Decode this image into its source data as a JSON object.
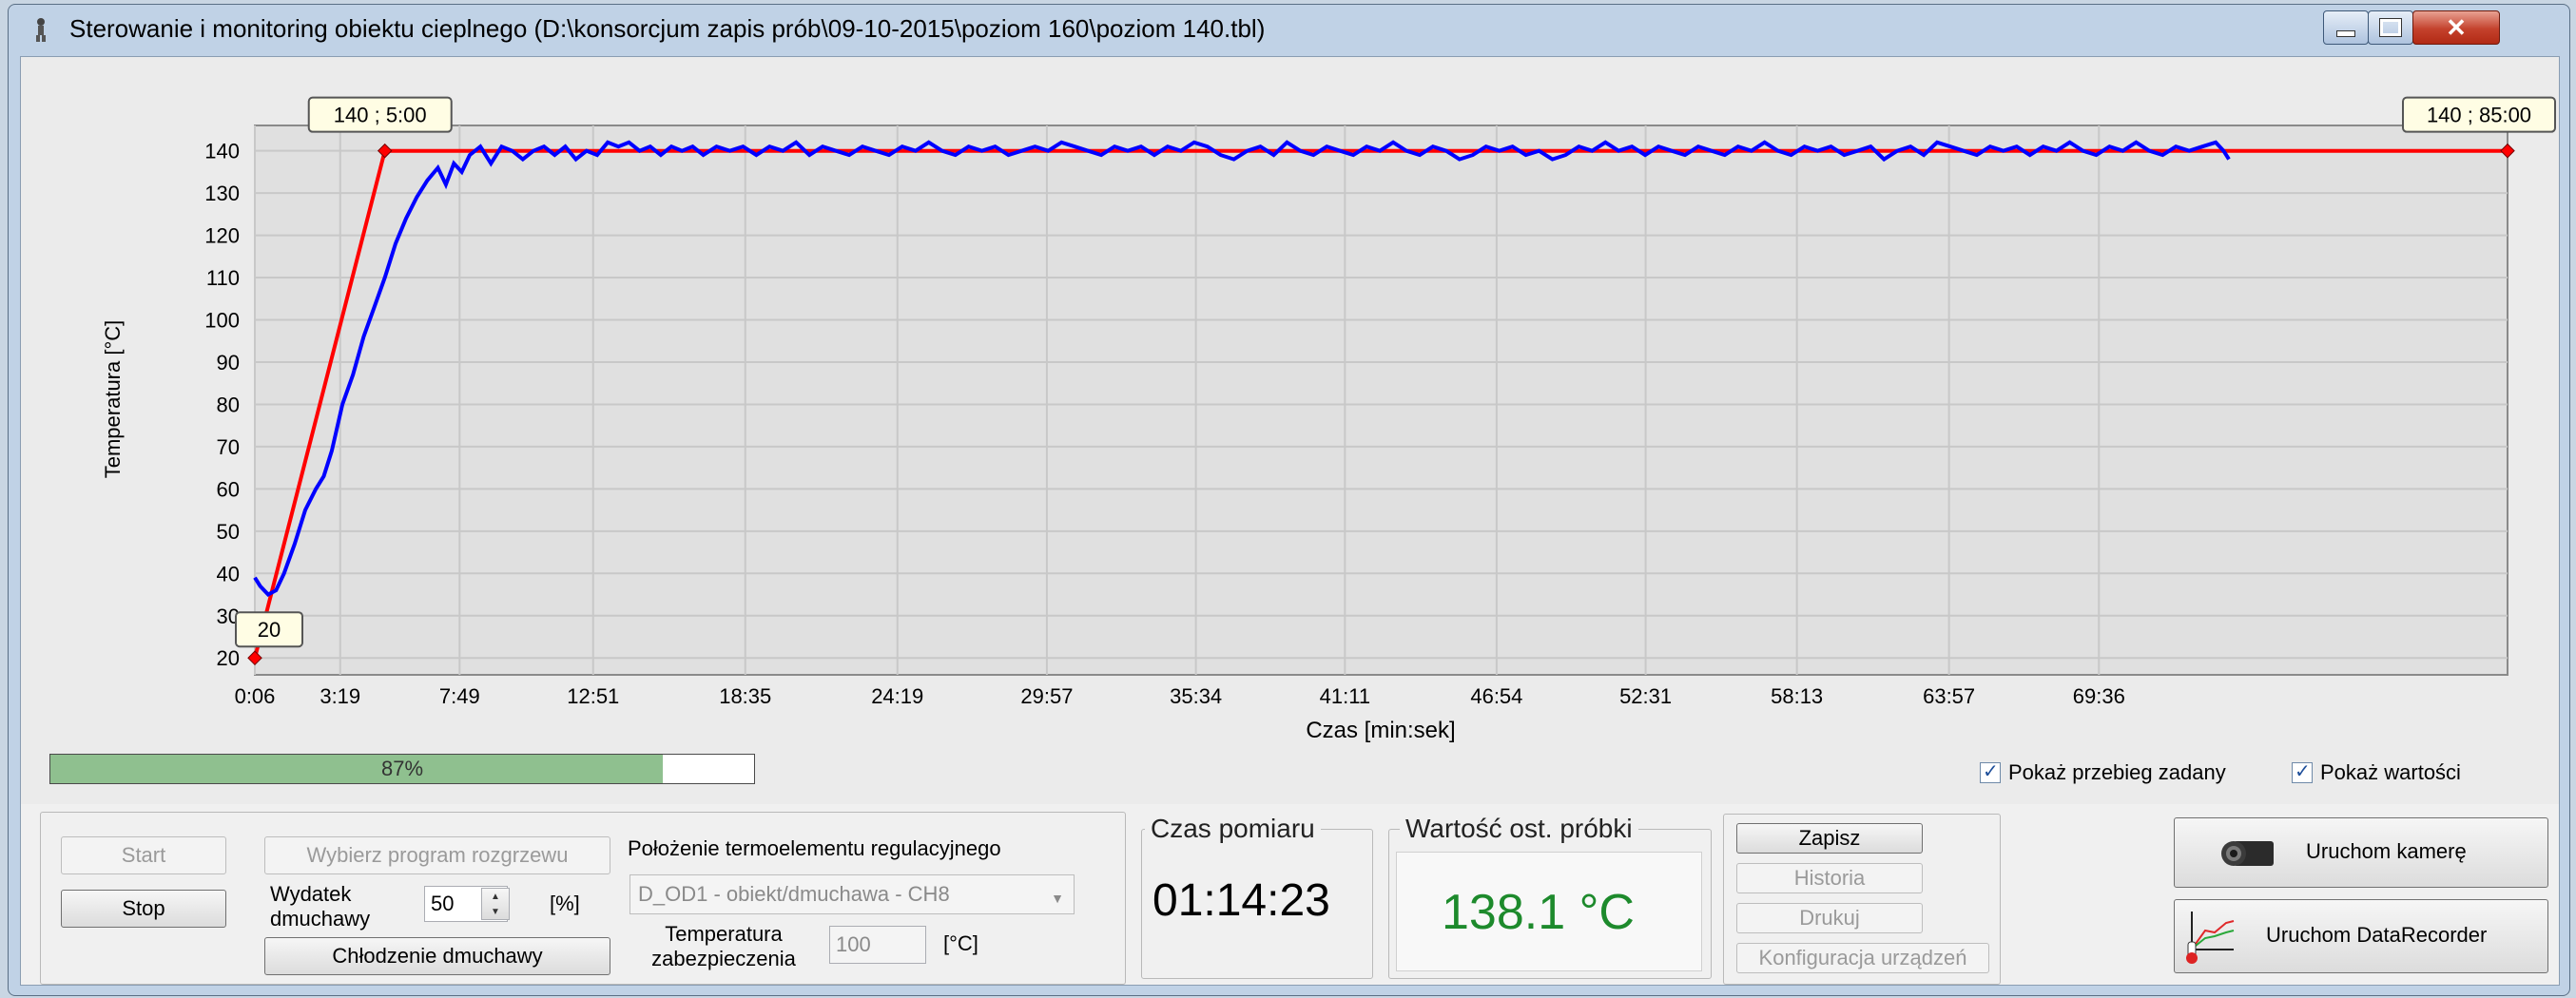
{
  "window": {
    "title": "Sterowanie i monitoring obiektu cieplnego (D:\\konsorcjum zapis prób\\09-10-2015\\poziom 160\\poziom 140.tbl)",
    "controls": {
      "minimize": "minimize-icon",
      "maximize": "maximize-icon",
      "close": "close-icon"
    }
  },
  "chart_data": {
    "type": "line",
    "title": "",
    "xlabel": "Czas [min:sek]",
    "ylabel": "Temperatura [°C]",
    "ylim": [
      16,
      146
    ],
    "yticks": [
      20,
      30,
      40,
      50,
      60,
      70,
      80,
      90,
      100,
      110,
      120,
      130,
      140
    ],
    "xticks": [
      "0:06",
      "3:19",
      "7:49",
      "12:51",
      "18:35",
      "24:19",
      "29:57",
      "35:34",
      "41:11",
      "46:54",
      "52:31",
      "58:13",
      "63:57",
      "69:36"
    ],
    "xtick_minutes": [
      0.1,
      3.3167,
      7.8167,
      12.85,
      18.5833,
      24.3167,
      29.95,
      35.5667,
      41.1833,
      46.9,
      52.5167,
      58.2167,
      63.95,
      69.6
    ],
    "xlim_minutes": [
      0.1,
      85
    ],
    "grid": true,
    "colors": {
      "setpoint": "#ff0000",
      "measured": "#0000ff"
    },
    "annotations": [
      {
        "text": "140 ; 5:00",
        "x_min": 5.0,
        "y": 140
      },
      {
        "text": "140 ; 85:00",
        "x_min": 85.0,
        "y": 140
      },
      {
        "text": "20",
        "x_min": 0.1,
        "y": 20
      }
    ],
    "series": [
      {
        "name": "Przebieg zadany",
        "points": [
          [
            0.1,
            20
          ],
          [
            5.0,
            140
          ],
          [
            85.0,
            140
          ]
        ]
      },
      {
        "name": "Wartość",
        "points": [
          [
            0.1,
            39
          ],
          [
            0.3,
            37
          ],
          [
            0.6,
            35
          ],
          [
            0.9,
            36
          ],
          [
            1.2,
            40
          ],
          [
            1.6,
            47
          ],
          [
            2.0,
            55
          ],
          [
            2.4,
            60
          ],
          [
            2.7,
            63
          ],
          [
            3.0,
            69
          ],
          [
            3.4,
            80
          ],
          [
            3.8,
            87
          ],
          [
            4.2,
            96
          ],
          [
            4.6,
            103
          ],
          [
            5.0,
            110
          ],
          [
            5.4,
            118
          ],
          [
            5.8,
            124
          ],
          [
            6.2,
            129
          ],
          [
            6.6,
            133
          ],
          [
            7.0,
            136
          ],
          [
            7.3,
            132
          ],
          [
            7.6,
            137
          ],
          [
            7.9,
            135
          ],
          [
            8.2,
            139
          ],
          [
            8.6,
            141
          ],
          [
            9.0,
            137
          ],
          [
            9.4,
            141
          ],
          [
            9.8,
            140
          ],
          [
            10.2,
            138
          ],
          [
            10.6,
            140
          ],
          [
            11.0,
            141
          ],
          [
            11.4,
            139
          ],
          [
            11.8,
            141
          ],
          [
            12.2,
            138
          ],
          [
            12.6,
            140
          ],
          [
            13.0,
            139
          ],
          [
            13.4,
            142
          ],
          [
            13.8,
            141
          ],
          [
            14.2,
            142
          ],
          [
            14.6,
            140
          ],
          [
            15.0,
            141
          ],
          [
            15.4,
            139
          ],
          [
            15.8,
            141
          ],
          [
            16.2,
            140
          ],
          [
            16.6,
            141
          ],
          [
            17.0,
            139
          ],
          [
            17.5,
            141
          ],
          [
            18.0,
            140
          ],
          [
            18.5,
            141
          ],
          [
            19.0,
            139
          ],
          [
            19.5,
            141
          ],
          [
            20.0,
            140
          ],
          [
            20.5,
            142
          ],
          [
            21.0,
            139
          ],
          [
            21.5,
            141
          ],
          [
            22.0,
            140
          ],
          [
            22.5,
            139
          ],
          [
            23.0,
            141
          ],
          [
            23.5,
            140
          ],
          [
            24.0,
            139
          ],
          [
            24.5,
            141
          ],
          [
            25.0,
            140
          ],
          [
            25.5,
            142
          ],
          [
            26.0,
            140
          ],
          [
            26.5,
            139
          ],
          [
            27.0,
            141
          ],
          [
            27.5,
            140
          ],
          [
            28.0,
            141
          ],
          [
            28.5,
            139
          ],
          [
            29.0,
            140
          ],
          [
            29.5,
            141
          ],
          [
            30.0,
            140
          ],
          [
            30.5,
            142
          ],
          [
            31.0,
            141
          ],
          [
            31.5,
            140
          ],
          [
            32.0,
            139
          ],
          [
            32.5,
            141
          ],
          [
            33.0,
            140
          ],
          [
            33.5,
            141
          ],
          [
            34.0,
            139
          ],
          [
            34.5,
            141
          ],
          [
            35.0,
            140
          ],
          [
            35.5,
            142
          ],
          [
            36.0,
            141
          ],
          [
            36.5,
            139
          ],
          [
            37.0,
            138
          ],
          [
            37.5,
            140
          ],
          [
            38.0,
            141
          ],
          [
            38.5,
            139
          ],
          [
            39.0,
            142
          ],
          [
            39.5,
            140
          ],
          [
            40.0,
            139
          ],
          [
            40.5,
            141
          ],
          [
            41.0,
            140
          ],
          [
            41.5,
            139
          ],
          [
            42.0,
            141
          ],
          [
            42.5,
            140
          ],
          [
            43.0,
            142
          ],
          [
            43.5,
            140
          ],
          [
            44.0,
            139
          ],
          [
            44.5,
            141
          ],
          [
            45.0,
            140
          ],
          [
            45.5,
            138
          ],
          [
            46.0,
            139
          ],
          [
            46.5,
            141
          ],
          [
            47.0,
            140
          ],
          [
            47.5,
            141
          ],
          [
            48.0,
            139
          ],
          [
            48.5,
            140
          ],
          [
            49.0,
            138
          ],
          [
            49.5,
            139
          ],
          [
            50.0,
            141
          ],
          [
            50.5,
            140
          ],
          [
            51.0,
            142
          ],
          [
            51.5,
            140
          ],
          [
            52.0,
            141
          ],
          [
            52.5,
            139
          ],
          [
            53.0,
            141
          ],
          [
            53.5,
            140
          ],
          [
            54.0,
            139
          ],
          [
            54.5,
            141
          ],
          [
            55.0,
            140
          ],
          [
            55.5,
            139
          ],
          [
            56.0,
            141
          ],
          [
            56.5,
            140
          ],
          [
            57.0,
            142
          ],
          [
            57.5,
            140
          ],
          [
            58.0,
            139
          ],
          [
            58.5,
            141
          ],
          [
            59.0,
            140
          ],
          [
            59.5,
            141
          ],
          [
            60.0,
            139
          ],
          [
            60.5,
            140
          ],
          [
            61.0,
            141
          ],
          [
            61.5,
            138
          ],
          [
            62.0,
            140
          ],
          [
            62.5,
            141
          ],
          [
            63.0,
            139
          ],
          [
            63.5,
            142
          ],
          [
            64.0,
            141
          ],
          [
            64.5,
            140
          ],
          [
            65.0,
            139
          ],
          [
            65.5,
            141
          ],
          [
            66.0,
            140
          ],
          [
            66.5,
            141
          ],
          [
            67.0,
            139
          ],
          [
            67.5,
            141
          ],
          [
            68.0,
            140
          ],
          [
            68.5,
            142
          ],
          [
            69.0,
            140
          ],
          [
            69.5,
            139
          ],
          [
            70.0,
            141
          ],
          [
            70.5,
            140
          ],
          [
            71.0,
            142
          ],
          [
            71.5,
            140
          ],
          [
            72.0,
            139
          ],
          [
            72.5,
            141
          ],
          [
            73.0,
            140
          ],
          [
            73.5,
            141
          ],
          [
            74.0,
            142
          ],
          [
            74.3,
            140
          ],
          [
            74.5,
            138
          ]
        ]
      }
    ]
  },
  "progress": {
    "value": 0.87,
    "label": "87%"
  },
  "checkboxes": {
    "show_setpoint": {
      "label": "Pokaż przebieg zadany",
      "checked": true
    },
    "show_values": {
      "label": "Pokaż wartości",
      "checked": true
    }
  },
  "controls": {
    "start_label": "Start",
    "stop_label": "Stop",
    "choose_program_label": "Wybierz program rozgrzewu",
    "blower_output_label": "Wydatek dmuchawy",
    "blower_output_value": "50",
    "blower_output_unit": "[%]",
    "blower_cooling_label": "Chłodzenie dmuchawy",
    "thermocouple_label": "Położenie termoelementu regulacyjnego",
    "thermocouple_value": "D_OD1 - obiekt/dmuchawa - CH8",
    "safety_temp_label": "Temperatura zabezpieczenia",
    "safety_temp_value": "100",
    "safety_temp_unit": "[°C]"
  },
  "measurement_time": {
    "title": "Czas pomiaru",
    "value": "01:14:23"
  },
  "last_sample": {
    "title": "Wartość ost. próbki",
    "value": "138.1 °C"
  },
  "actions": {
    "save": "Zapisz",
    "history": "Historia",
    "print": "Drukuj",
    "device_config": "Konfiguracja urządzeń"
  },
  "launch": {
    "camera": "Uruchom kamerę",
    "datarecorder": "Uruchom DataRecorder"
  }
}
